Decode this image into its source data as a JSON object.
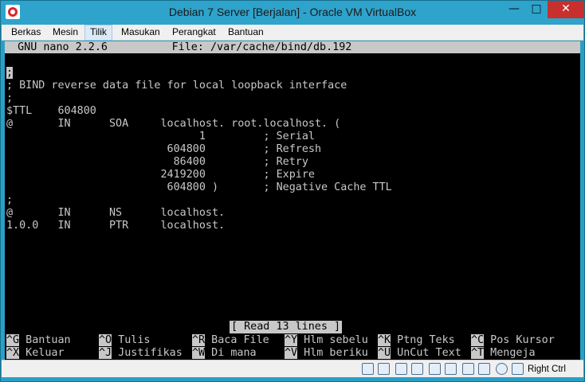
{
  "window": {
    "title": "Debian 7 Server [Berjalan] - Oracle VM VirtualBox",
    "min_glyph": "—",
    "max_glyph": "□",
    "close_glyph": "✕"
  },
  "menu": [
    "Berkas",
    "Mesin",
    "Tilik",
    "Masukan",
    "Perangkat",
    "Bantuan"
  ],
  "nano": {
    "header": "  GNU nano 2.2.6          File: /var/cache/bind/db.192",
    "cursor_line": ";",
    "lines": [
      "; BIND reverse data file for local loopback interface",
      ";",
      "$TTL    604800",
      "@       IN      SOA     localhost. root.localhost. (",
      "                              1         ; Serial",
      "                         604800         ; Refresh",
      "                          86400         ; Retry",
      "                        2419200         ; Expire",
      "                         604800 )       ; Negative Cache TTL",
      ";",
      "@       IN      NS      localhost.",
      "1.0.0   IN      PTR     localhost."
    ],
    "status": "[ Read 13 lines ]",
    "shortcuts_row1": [
      {
        "key": "^G",
        "label": " Bantuan"
      },
      {
        "key": "^O",
        "label": " Tulis"
      },
      {
        "key": "^R",
        "label": " Baca File"
      },
      {
        "key": "^Y",
        "label": " Hlm sebelu"
      },
      {
        "key": "^K",
        "label": " Ptng Teks"
      },
      {
        "key": "^C",
        "label": " Pos Kursor"
      }
    ],
    "shortcuts_row2": [
      {
        "key": "^X",
        "label": " Keluar"
      },
      {
        "key": "^J",
        "label": " Justifikas"
      },
      {
        "key": "^W",
        "label": " Di mana"
      },
      {
        "key": "^V",
        "label": " Hlm beriku"
      },
      {
        "key": "^U",
        "label": " UnCut Text"
      },
      {
        "key": "^T",
        "label": " Mengeja"
      }
    ]
  },
  "statusbar": {
    "host_key": "Right Ctrl",
    "icons": [
      "hdd-icon",
      "cd-icon",
      "usb-icon",
      "pen-icon",
      "shared-icon",
      "display-icon",
      "capture-icon",
      "cpu-icon",
      "net-icon",
      "mouse-icon"
    ]
  },
  "colors": {
    "titlebar": "#2ea3cb",
    "close_button": "#c7302d",
    "terminal_bg": "#000000",
    "terminal_fg": "#c8c8c8"
  }
}
